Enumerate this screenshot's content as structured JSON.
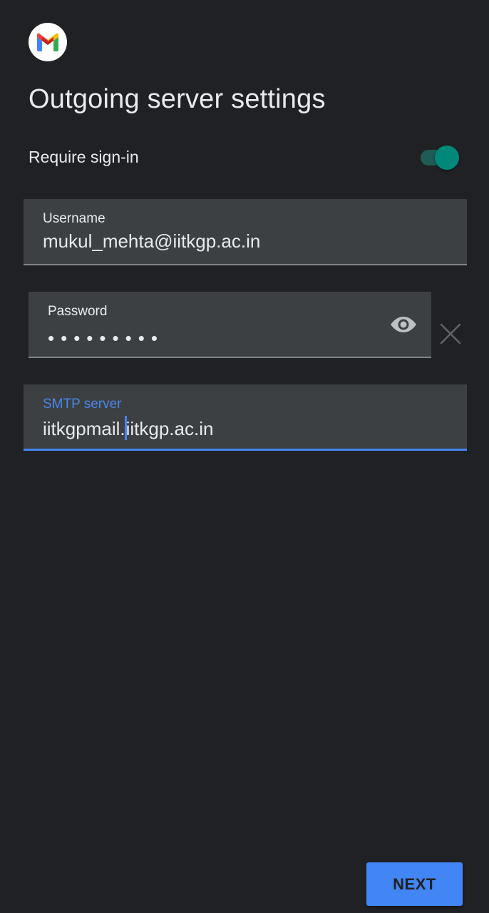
{
  "app": {
    "logo_icon": "gmail-logo-icon"
  },
  "header": {
    "title": "Outgoing server settings"
  },
  "require_signin": {
    "label": "Require sign-in",
    "enabled": true,
    "accent_color": "#00897b"
  },
  "fields": {
    "username": {
      "label": "Username",
      "value": "mukul_mehta@iitkgp.ac.in"
    },
    "password": {
      "label": "Password",
      "masked_value": "•••••••••",
      "show_icon": "eye-icon",
      "clear_icon": "close-icon"
    },
    "smtp": {
      "label": "SMTP server",
      "value_before_cursor": "iitkgpmail.",
      "value_after_cursor": "iitkgp.ac.in",
      "focus_color": "#4285f4"
    }
  },
  "actions": {
    "next_label": "NEXT",
    "next_color": "#4285f4"
  }
}
